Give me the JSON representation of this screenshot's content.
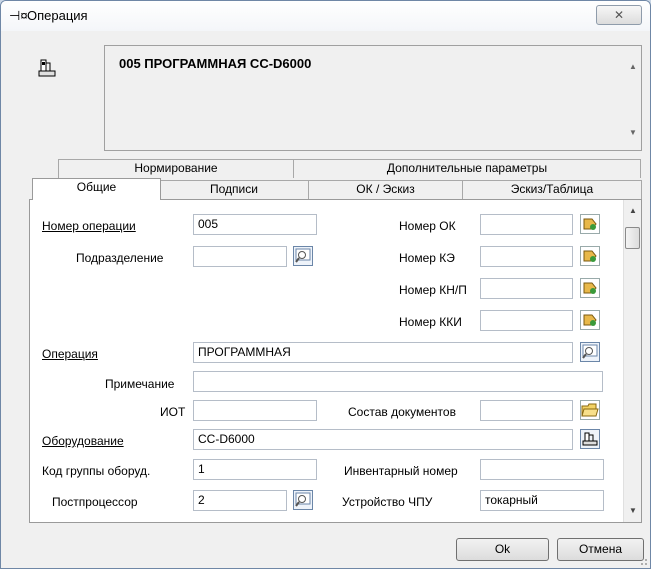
{
  "window": {
    "title": "Операция",
    "close_label": "X"
  },
  "header": {
    "operation_text": "005  ПРОГРАММНАЯ СС-D6000"
  },
  "tabs_top": [
    {
      "label": "Нормирование"
    },
    {
      "label": "Дополнительные параметры"
    }
  ],
  "tabs_bottom": [
    {
      "label": "Общие",
      "active": true
    },
    {
      "label": "Подписи"
    },
    {
      "label": "ОК / Эскиз"
    },
    {
      "label": "Эскиз/Таблица"
    }
  ],
  "form": {
    "op_number_label": "Номер операции",
    "op_number_value": "005",
    "subdivision_label": "Подразделение",
    "subdivision_value": "",
    "ok_number_label": "Номер ОК",
    "ok_number_value": "",
    "ke_number_label": "Номер КЭ",
    "ke_number_value": "",
    "knp_number_label": "Номер КН/П",
    "knp_number_value": "",
    "kki_number_label": "Номер ККИ",
    "kki_number_value": "",
    "operation_label": "Операция",
    "operation_value": "ПРОГРАММНАЯ",
    "note_label": "Примечание",
    "note_value": "",
    "iot_label": "ИОТ",
    "iot_value": "",
    "docs_label": "Состав документов",
    "docs_value": "",
    "equipment_label": "Оборудование",
    "equipment_value": "СС-D6000",
    "group_code_label": "Код группы оборуд.",
    "group_code_value": "1",
    "inventory_label": "Инвентарный номер",
    "inventory_value": "",
    "postprocessor_label": "Постпроцессор",
    "postprocessor_value": "2",
    "cnc_label": "Устройство ЧПУ",
    "cnc_value": "токарный"
  },
  "buttons": {
    "ok": "Ok",
    "cancel": "Отмена"
  },
  "colors": {
    "accent": "#d4a020",
    "border": "#a8a8a8",
    "panel": "#ffffff",
    "window": "#f0f0f0"
  }
}
